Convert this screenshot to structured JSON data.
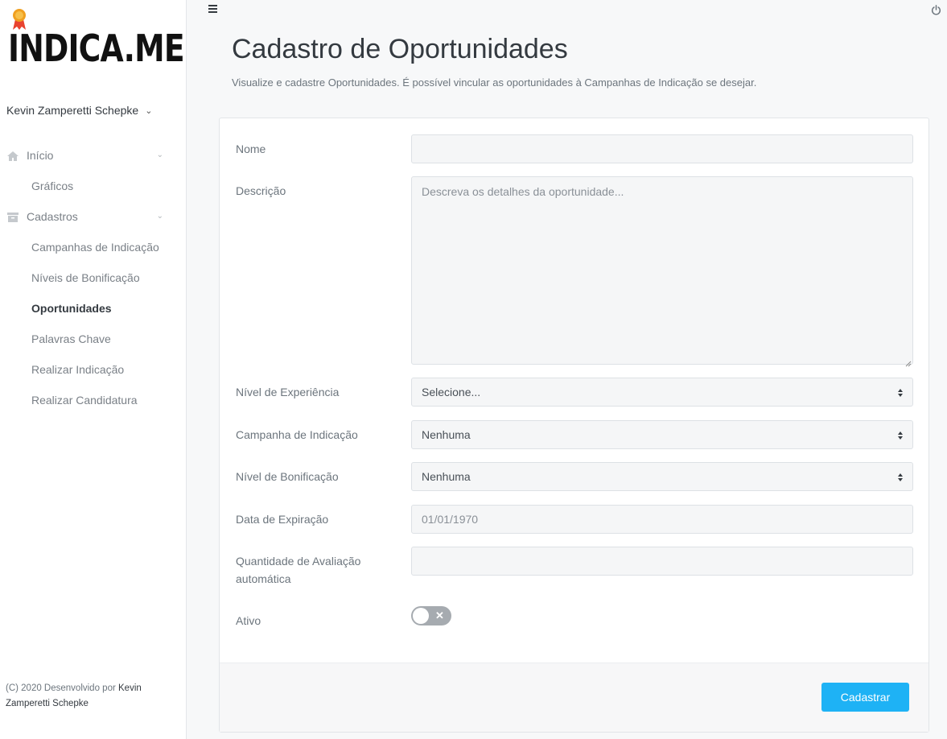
{
  "app": {
    "logo_text": "INDICA.ME"
  },
  "user": {
    "name": "Kevin Zamperetti Schepke"
  },
  "nav": {
    "groups": [
      {
        "label": "Início",
        "items": [
          "Gráficos"
        ]
      },
      {
        "label": "Cadastros",
        "items": [
          "Campanhas de Indicação",
          "Níveis de Bonificação",
          "Oportunidades",
          "Palavras Chave",
          "Realizar Indicação",
          "Realizar Candidatura"
        ]
      }
    ],
    "active_item": "Oportunidades"
  },
  "footer": {
    "prefix": "(C) 2020 Desenvolvido por",
    "author": "Kevin Zamperetti Schepke"
  },
  "page": {
    "title": "Cadastro de Oportunidades",
    "subtitle": "Visualize e cadastre Oportunidades. É possível vincular as oportunidades à Campanhas de Indicação se desejar."
  },
  "form": {
    "nome": {
      "label": "Nome",
      "value": ""
    },
    "descricao": {
      "label": "Descrição",
      "placeholder": "Descreva os detalhes da oportunidade..."
    },
    "nivel_experiencia": {
      "label": "Nível de Experiência",
      "selected": "Selecione..."
    },
    "campanha": {
      "label": "Campanha de Indicação",
      "selected": "Nenhuma"
    },
    "nivel_bonificacao": {
      "label": "Nível de Bonificação",
      "selected": "Nenhuma"
    },
    "data_expiracao": {
      "label": "Data de Expiração",
      "value": "01/01/1970"
    },
    "quantidade": {
      "label": "Quantidade de Avaliação automática",
      "value": ""
    },
    "ativo": {
      "label": "Ativo",
      "checked": false
    },
    "submit_label": "Cadastrar"
  },
  "colors": {
    "accent": "#1eb2f5",
    "toggle_off": "#a6abb0"
  }
}
